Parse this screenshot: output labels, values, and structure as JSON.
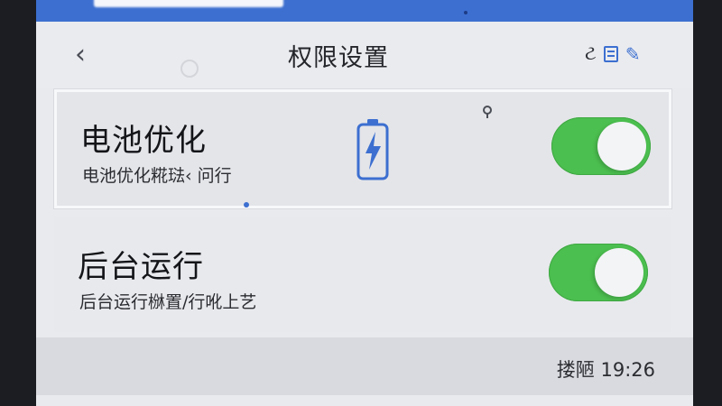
{
  "header": {
    "back_glyph": "‹",
    "title": "权限设置",
    "actions": {
      "first_glyph": "ટ",
      "edit_glyph": "✎"
    }
  },
  "cards": {
    "battery": {
      "title": "电池优化",
      "description": "电池优化糀琺‹ 问行",
      "toggle_on": true
    },
    "background": {
      "title": "后台运行",
      "description": "后台运行椕置/行吪上艺",
      "toggle_on": true
    }
  },
  "footer": {
    "text": "搂陋 19:26"
  },
  "colors": {
    "accent_blue": "#3c6fd0",
    "toggle_green": "#4bbf4f",
    "background": "#e9eaee"
  },
  "icons": [
    "chevron-left-icon",
    "doc-icon",
    "edit-icon",
    "battery-charging-icon",
    "search-icon"
  ]
}
